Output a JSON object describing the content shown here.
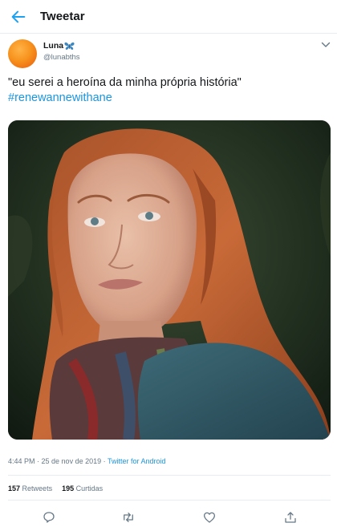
{
  "header": {
    "title": "Tweetar"
  },
  "author": {
    "name": "Luna",
    "handle": "@lunabths"
  },
  "tweet": {
    "text": "\"eu serei a heroína da minha própria história\"",
    "hashtag": "#renewannewithane"
  },
  "meta": {
    "time": "4:44 PM",
    "sep1": " · ",
    "date": "25 de nov de 2019",
    "sep2": " · ",
    "source": "Twitter for Android"
  },
  "stats": {
    "retweets_count": "157",
    "retweets_label": "Retweets",
    "likes_count": "195",
    "likes_label": "Curtidas"
  },
  "icons": {
    "back": "arrow-left-icon",
    "menu": "chevron-down-icon",
    "reply": "reply-icon",
    "retweet": "retweet-icon",
    "like": "heart-icon",
    "share": "share-icon"
  },
  "colors": {
    "accent": "#1da1f2",
    "link": "#1b95e0",
    "muted": "#657786"
  }
}
